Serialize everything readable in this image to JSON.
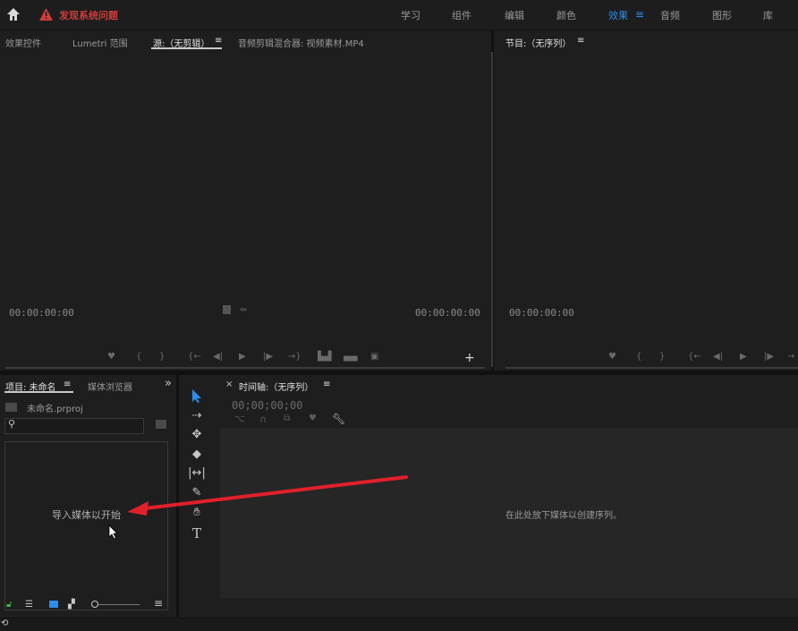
{
  "header": {
    "warning_text": "发现系统问题",
    "workspaces": [
      "学习",
      "组件",
      "编辑",
      "颜色",
      "效果",
      "音频",
      "图形",
      "库"
    ],
    "active_workspace": "效果",
    "menu_icon": "≡"
  },
  "source_panel": {
    "tabs": [
      "效果控件",
      "Lumetri 范围",
      "源:（无剪辑）",
      "音频剪辑混合器: 视频素材.MP4"
    ],
    "menu_icon": "≡",
    "timecode_left": "00:00:00:00",
    "timecode_right": "00:00:00:00"
  },
  "program_panel": {
    "title": "节目:（无序列）",
    "menu_icon": "≡",
    "timecode_left": "00:00:00:00"
  },
  "project_panel": {
    "tab_project": "项目: 未命名",
    "menu_icon": "≡",
    "tab_media_browser": "媒体浏览器",
    "more_icon": "»",
    "project_file": "未命名.prproj",
    "import_hint": "导入媒体以开始"
  },
  "timeline_panel": {
    "close_icon": "×",
    "title": "时间轴:（无序列）",
    "menu_icon": "≡",
    "timecode": "00;00;00;00",
    "drop_hint": "在此处放下媒体以创建序列。"
  },
  "colors": {
    "accent": "#2d8ceb",
    "warning": "#d13b3b",
    "arrow": "#e0202a"
  }
}
